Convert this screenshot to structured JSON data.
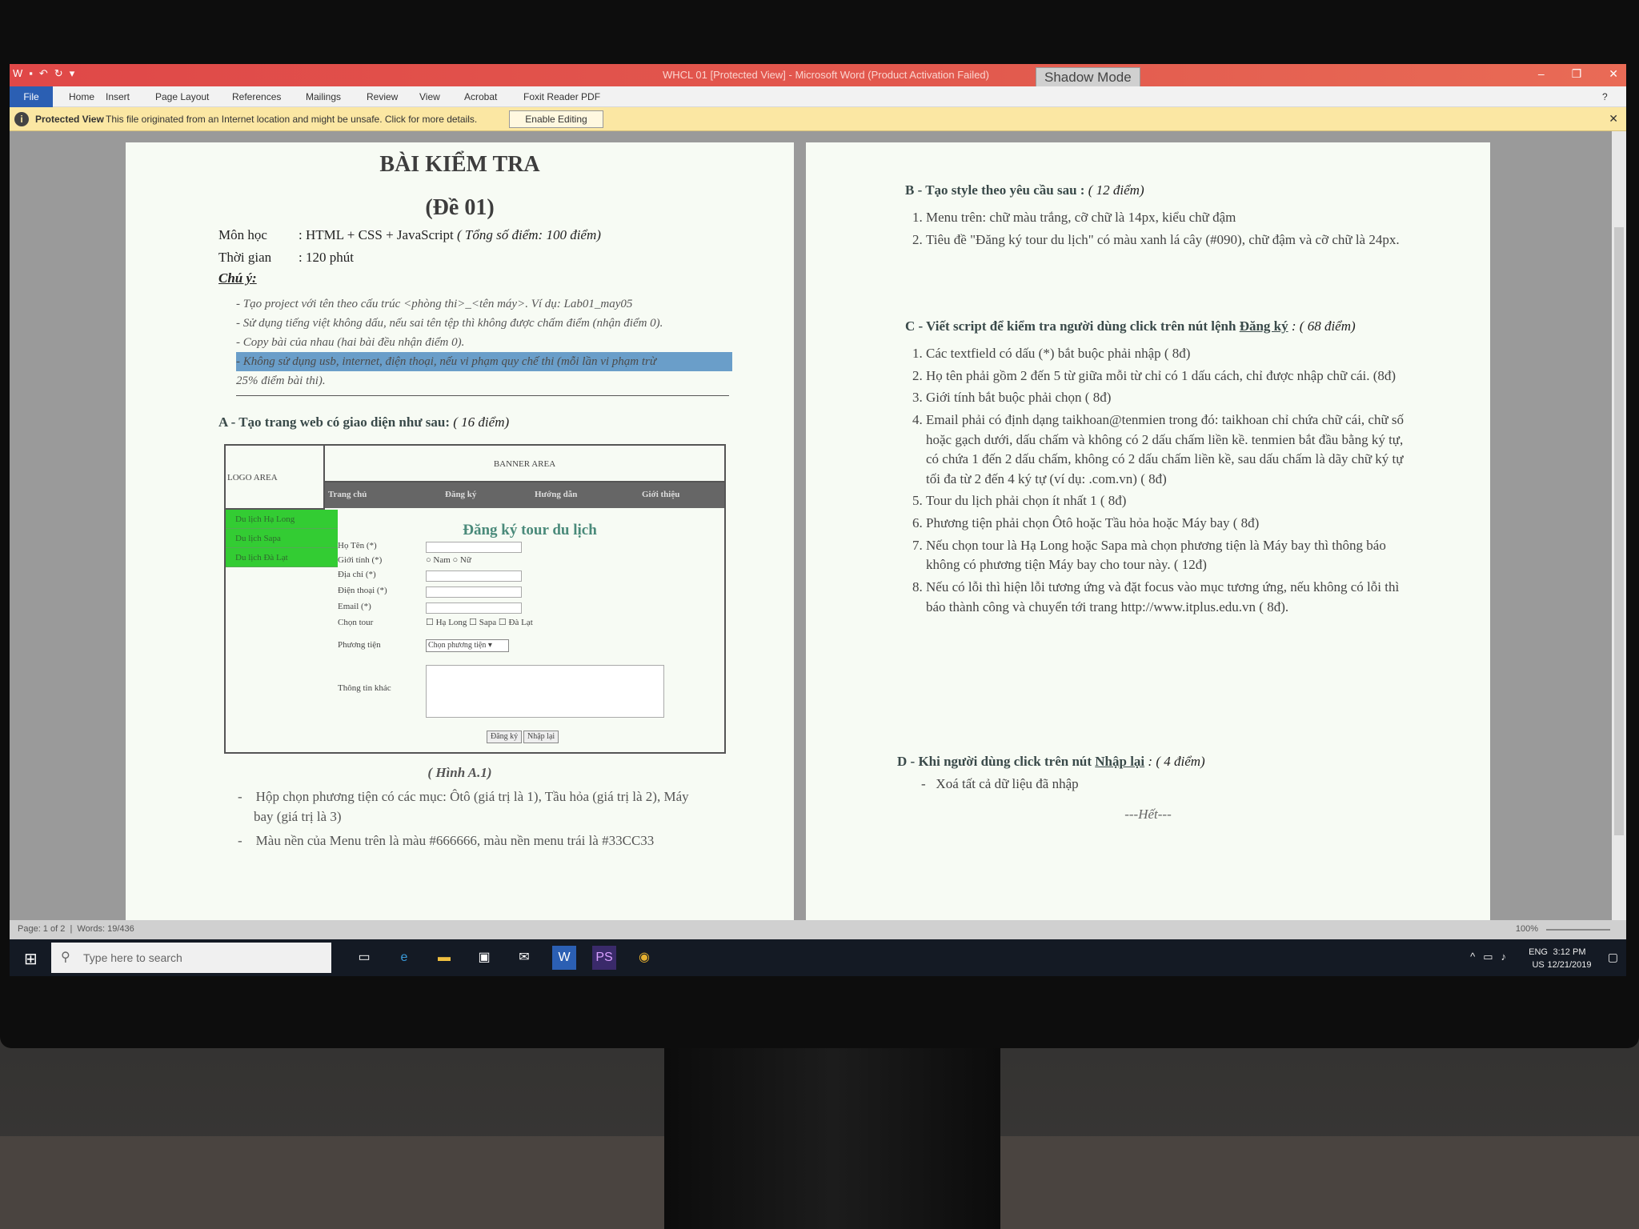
{
  "window": {
    "title": "WHCL 01 [Protected View] - Microsoft Word (Product Activation Failed)",
    "shadow_badge": "Shadow Mode",
    "minimize": "–",
    "restore": "❐",
    "close": "✕"
  },
  "ribbon": {
    "tabs": [
      "File",
      "Home",
      "Insert",
      "Page Layout",
      "References",
      "Mailings",
      "Review",
      "View",
      "Acrobat",
      "Foxit Reader PDF"
    ]
  },
  "protected_view": {
    "label": "Protected View",
    "message": "This file originated from an Internet location and might be unsafe. Click for more details.",
    "button": "Enable Editing"
  },
  "left_page": {
    "title": "BÀI KIỂM TRA",
    "subtitle": "(Đề 01)",
    "subject_label": "Môn học",
    "subject_value": ": HTML + CSS + JavaScript",
    "subject_points": "( Tổng số điểm: 100 điểm)",
    "time_label": "Thời gian",
    "time_value": ": 120 phút",
    "note_title": "Chú ý:",
    "notes": [
      "- Tạo project với tên theo cấu trúc <phòng thi>_<tên máy>. Ví dụ: Lab01_may05",
      "- Sử dụng tiếng việt không dấu, nếu sai tên tệp thì không được chấm điểm (nhận điểm 0).",
      "- Copy bài của nhau (hai bài đều nhận điểm 0)."
    ],
    "highlight_note_1": "- Không sử dụng usb, internet, điện thoại, nếu vi phạm quy chế thi (mỗi lần vi phạm trừ",
    "highlight_note_2": "25% điểm bài thi).",
    "section_a": "A - Tạo trang web có giao diện như sau:",
    "section_a_points": "( 16 điểm)",
    "caption": "( Hình A.1)",
    "bullet_1a": "Hộp chọn phương tiện có các mục: Ôtô (giá trị là 1), Tầu hỏa (giá trị là 2), Máy",
    "bullet_1b": "bay (giá trị là 3)",
    "bullet_2": "Màu nền của Menu trên là màu #666666, màu nền menu trái là #33CC33"
  },
  "mockup": {
    "logo": "LOGO AREA",
    "banner": "BANNER AREA",
    "menu": [
      "Trang chủ",
      "Đăng ký",
      "Hướng dẫn",
      "Giới thiệu"
    ],
    "left_menu": [
      "Du lịch Hạ Long",
      "Du lịch Sapa",
      "Du lịch Đà Lạt"
    ],
    "form_title": "Đăng ký tour du lịch",
    "labels": {
      "name": "Họ Tên (*)",
      "gender": "Giới tính (*)",
      "address": "Địa chỉ (*)",
      "phone": "Điện thoại (*)",
      "email": "Email (*)",
      "tour": "Chọn tour",
      "transport": "Phương tiện",
      "info": "Thông tin khác"
    },
    "gender_options": "○ Nam  ○ Nữ",
    "tour_options": "☐ Hạ Long  ☐ Sapa  ☐ Đà Lạt",
    "select": "Chọn phương tiện ▾",
    "submit": "Đăng ký",
    "reset": "Nhập lại"
  },
  "right_page": {
    "section_b": "B - Tạo style theo yêu cầu sau :",
    "section_b_points": "( 12 điểm)",
    "b_items": [
      "Menu trên: chữ màu trắng, cỡ chữ là 14px, kiểu chữ đậm",
      "Tiêu đề \"Đăng ký tour du lịch\" có màu xanh lá cây (#090), chữ đậm và cỡ chữ là 24px."
    ],
    "section_c": "C - Viết script để kiểm tra người dùng click trên nút lệnh",
    "section_c_link": "Đăng ký",
    "section_c_points": ": ( 68 điểm)",
    "c_items": [
      "Các textfield có dấu (*) bắt buộc phải nhập ( 8đ)",
      "Họ tên phải gồm 2 đến 5 từ giữa mỗi từ chỉ có 1 dấu cách, chỉ được nhập chữ cái. (8đ)",
      "Giới tính bắt buộc phải chọn ( 8đ)",
      "Email phải có định dạng taikhoan@tenmien trong đó: taikhoan chỉ chứa chữ cái, chữ số hoặc gạch dưới, dấu chấm và không có 2 dấu chấm liền kề. tenmien bắt đầu bằng ký tự, có chứa 1 đến 2 dấu chấm, không có 2 dấu chấm liền kề, sau dấu chấm là dãy chữ ký tự tối đa từ 2 đến 4 ký tự (ví dụ: .com.vn) ( 8đ)",
      "Tour du lịch phải chọn ít nhất 1 ( 8đ)",
      "Phương tiện phải chọn Ôtô hoặc Tầu hỏa hoặc Máy bay ( 8đ)",
      "Nếu chọn tour là Hạ Long hoặc Sapa mà chọn phương tiện là Máy bay thì thông báo không có phương tiện Máy bay cho tour này. ( 12đ)",
      "Nếu có lỗi thì hiện lỗi tương ứng và đặt focus vào mục tương ứng, nếu không có lỗi thì báo thành công và chuyển tới trang http://www.itplus.edu.vn ( 8đ)."
    ],
    "section_d": "D - Khi người dùng click trên nút",
    "section_d_link": "Nhập lại",
    "section_d_points": ": ( 4 điểm)",
    "d_item": "Xoá tất cả dữ liệu đã nhập",
    "end": "---Hết---"
  },
  "status": {
    "page": "Page: 1 of 2",
    "words": "Words: 19/436",
    "zoom": "100%"
  },
  "taskbar": {
    "search_placeholder": "Type here to search",
    "lang_1": "ENG",
    "lang_2": "US",
    "time": "3:12 PM",
    "date": "12/21/2019"
  }
}
